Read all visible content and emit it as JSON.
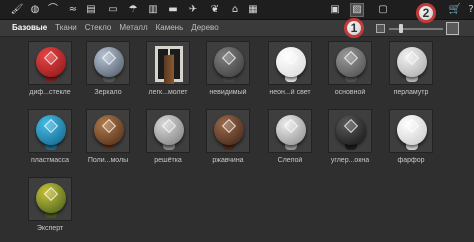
{
  "toolbar": {
    "icons": [
      {
        "name": "paint-roller-icon",
        "glyph": "🖌"
      },
      {
        "name": "materials-icon",
        "glyph": "◍"
      },
      {
        "name": "lamp-icon",
        "glyph": "⌒"
      },
      {
        "name": "wave-icon",
        "glyph": "≈"
      },
      {
        "name": "stripes-icon",
        "glyph": "▤"
      },
      {
        "name": "sofa-icon",
        "glyph": "▭"
      },
      {
        "name": "lamp-stand-icon",
        "glyph": "☂"
      },
      {
        "name": "book-icon",
        "glyph": "▥"
      },
      {
        "name": "car-icon",
        "glyph": "▬"
      },
      {
        "name": "bird-icon",
        "glyph": "✈"
      },
      {
        "name": "leaf-icon",
        "glyph": "❦"
      },
      {
        "name": "scene-icon",
        "glyph": "⌂"
      },
      {
        "name": "shelf-icon",
        "glyph": "▦"
      },
      {
        "name": "window-icon",
        "glyph": "▣"
      },
      {
        "name": "image-icon",
        "glyph": "▨"
      },
      {
        "name": "folder-icon",
        "glyph": "▢"
      },
      {
        "name": "cart-icon",
        "glyph": "🛒"
      },
      {
        "name": "help-icon",
        "glyph": "?"
      }
    ]
  },
  "filter_tabs": [
    "Базовые",
    "Ткани",
    "Стекло",
    "Металл",
    "Камень",
    "Дерево"
  ],
  "callouts": {
    "one": "1",
    "two": "2"
  },
  "zoom": {
    "level": 0.2
  },
  "materials": [
    {
      "label": "диф...стекле",
      "colors": [
        "#e54646",
        "#8c1414"
      ],
      "stand": "#8a1c1c"
    },
    {
      "label": "Зеркало",
      "colors": [
        "#b8c4d4",
        "#4b5463"
      ],
      "stand": "#5a5a5a"
    },
    {
      "label": "легк...молет",
      "type": "door"
    },
    {
      "label": "невидимый",
      "colors": [
        "#7f7f7f",
        "#3a3a3a"
      ],
      "stand": "#4a4a4a"
    },
    {
      "label": "неон...й свет",
      "colors": [
        "#ffffff",
        "#d8d8d8"
      ],
      "stand": "#e0e0e0"
    },
    {
      "label": "основной",
      "colors": [
        "#9a9a9a",
        "#4a4a4a"
      ],
      "stand": "#555555"
    },
    {
      "label": "перламутр",
      "colors": [
        "#f2f2f2",
        "#a7a7a7"
      ],
      "stand": "#bcbcbc"
    },
    {
      "label": "пластмасса",
      "colors": [
        "#48bde6",
        "#0f5f86"
      ],
      "stand": "#1d6a8a"
    },
    {
      "label": "Поли...молы",
      "colors": [
        "#b07a4c",
        "#4a2a16"
      ],
      "stand": "#5a3520"
    },
    {
      "label": "решётка",
      "colors": [
        "#d8d8d8",
        "#7a7a7a"
      ],
      "stand": "#8a8a8a"
    },
    {
      "label": "ржавчина",
      "colors": [
        "#9c6a4a",
        "#3a2216"
      ],
      "stand": "#4a2a18"
    },
    {
      "label": "Слепой",
      "colors": [
        "#ececec",
        "#8a8a8a"
      ],
      "stand": "#9a9a9a"
    },
    {
      "label": "углер...окна",
      "colors": [
        "#5a5a5a",
        "#141414"
      ],
      "stand": "#1e1e1e"
    },
    {
      "label": "фарфор",
      "colors": [
        "#ffffff",
        "#c7c7c7"
      ],
      "stand": "#d5d5d5"
    },
    {
      "label": "Эксперт",
      "colors": [
        "#c8c23a",
        "#3f5a1a"
      ],
      "stand": "#4a5a20"
    }
  ]
}
